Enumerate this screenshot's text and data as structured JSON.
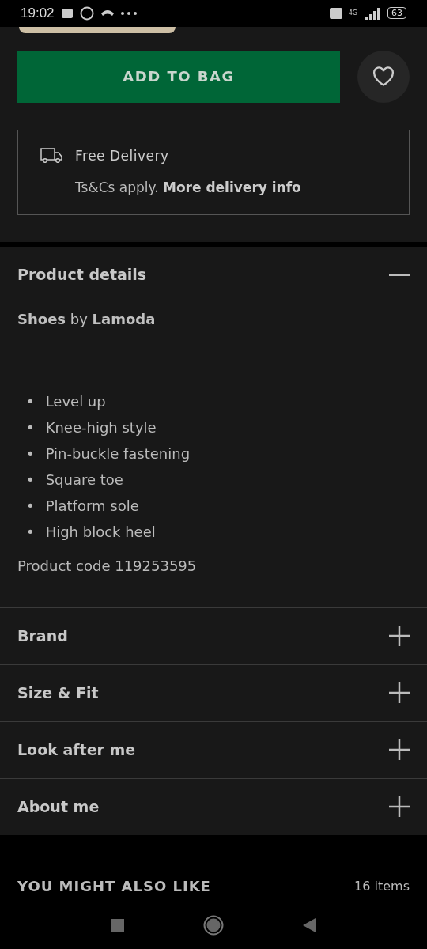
{
  "status_bar": {
    "time": "19:02",
    "network": "4G",
    "battery": "63"
  },
  "add_to_bag": {
    "label": "ADD TO BAG",
    "saved": false
  },
  "delivery": {
    "title": "Free Delivery",
    "note": "Ts&Cs apply.",
    "link": "More delivery info"
  },
  "accordion": [
    {
      "title": "Product details",
      "expanded": true,
      "summary": "**Shoes** by **Lamoda**",
      "marker": "•",
      "bullets": [
        "Level up",
        "Knee-high style",
        "Pin-buckle fastening",
        "Square toe",
        "Platform sole",
        "High block heel"
      ],
      "code": "Product code 119253595"
    },
    {
      "title": "Brand",
      "expanded": false
    },
    {
      "title": "Size & Fit",
      "expanded": false
    },
    {
      "title": "Look after me",
      "expanded": false
    },
    {
      "title": "About me",
      "expanded": false
    }
  ],
  "recommendations": {
    "title": "YOU MIGHT ALSO LIKE",
    "count": "16 items"
  }
}
